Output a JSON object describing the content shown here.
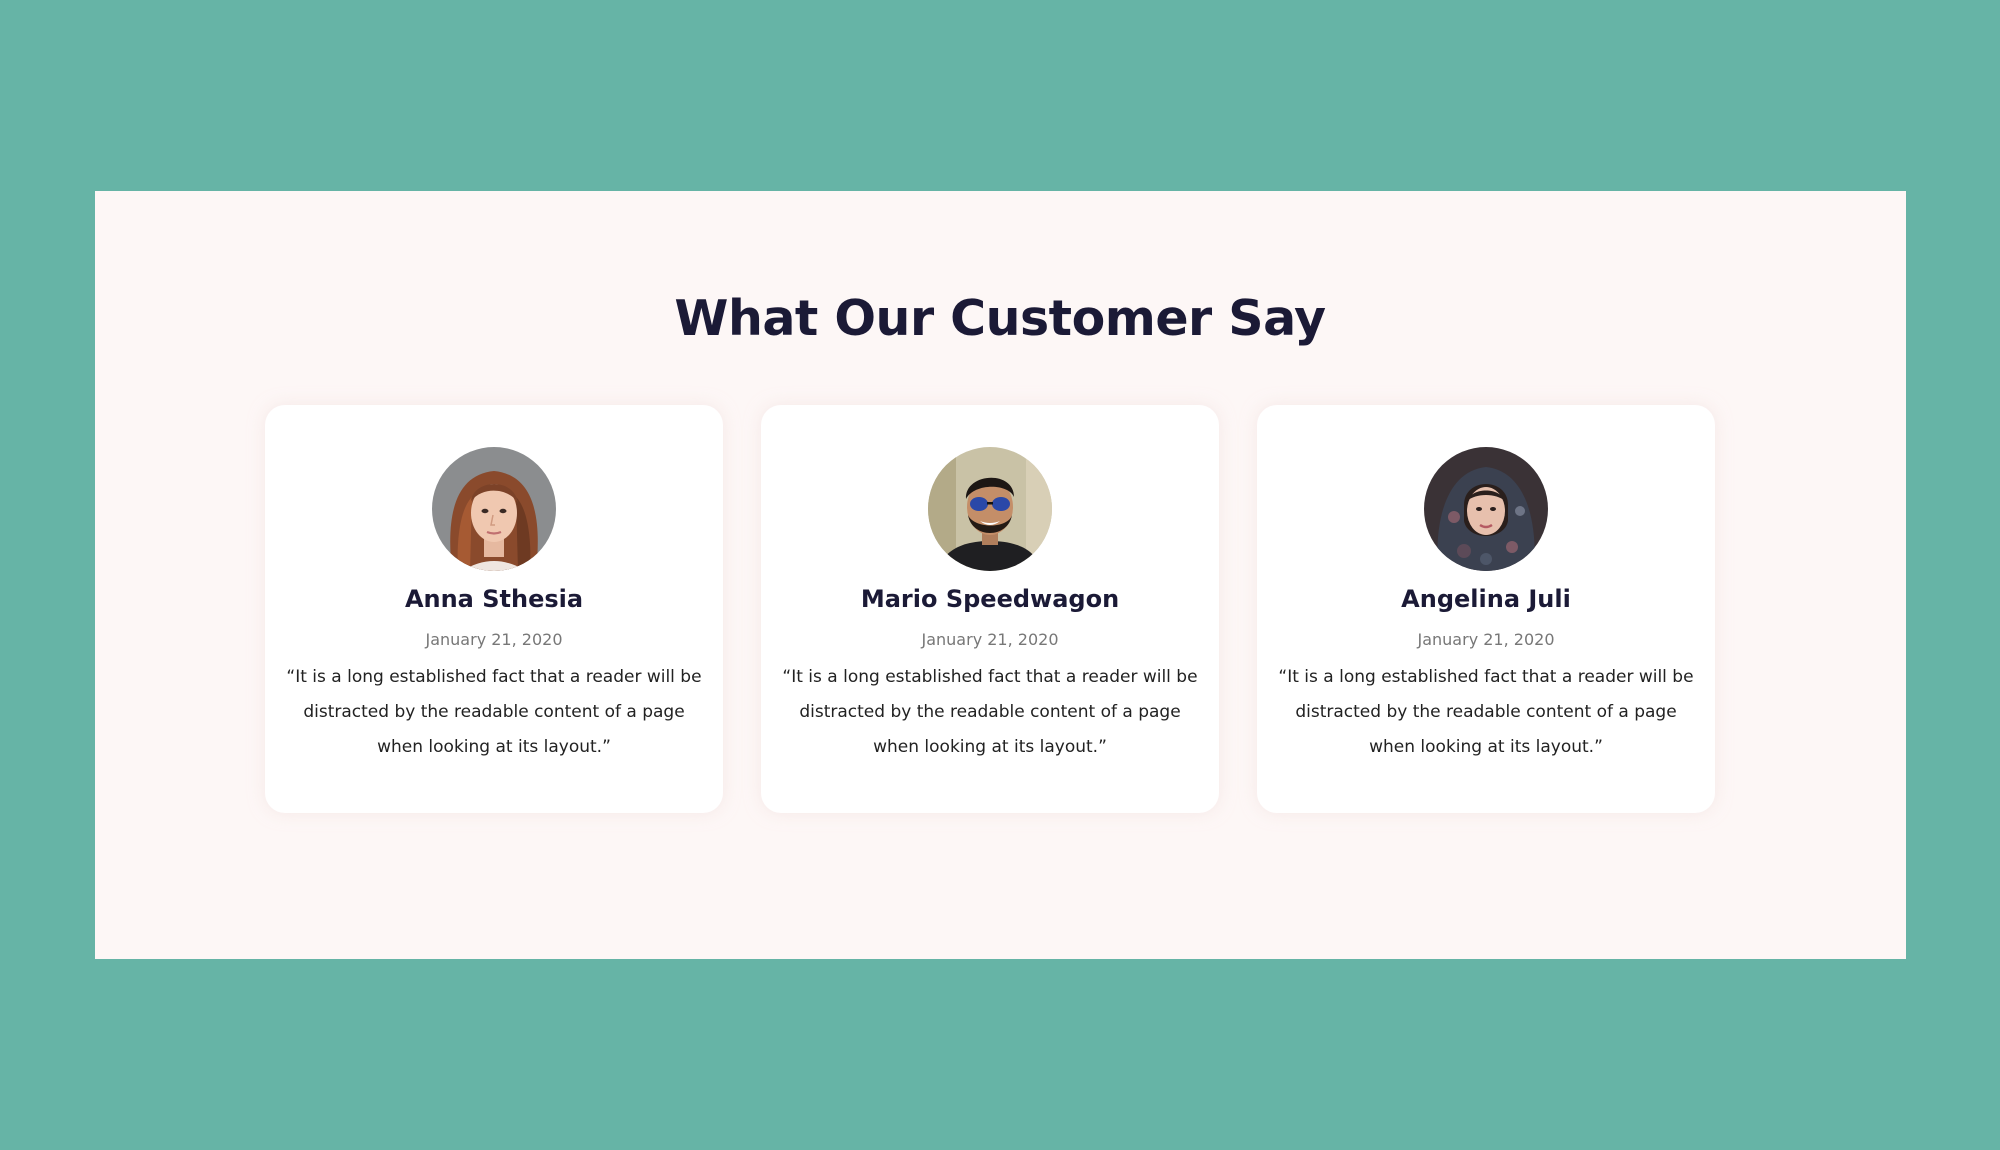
{
  "colors": {
    "background": "#66b4a6",
    "panel": "#fdf7f6",
    "card": "#ffffff",
    "heading": "#1b1a36",
    "date": "#777777",
    "text": "#222222"
  },
  "section": {
    "title": "What Our Customer Say"
  },
  "testimonials": [
    {
      "name": "Anna Sthesia",
      "date": "January 21, 2020",
      "quote": "“It is a long established fact that a reader will be distracted by the readable content of a page when looking at its layout.”",
      "avatar_icon": "avatar-woman-auburn-hair"
    },
    {
      "name": "Mario Speedwagon",
      "date": "January 21, 2020",
      "quote": "“It is a long established fact that a reader will be distracted by the readable content of a page when looking at its layout.”",
      "avatar_icon": "avatar-man-sunglasses"
    },
    {
      "name": "Angelina Juli",
      "date": "January 21, 2020",
      "quote": "“It is a long established fact that a reader will be distracted by the readable content of a page when looking at its layout.”",
      "avatar_icon": "avatar-woman-headscarf"
    }
  ]
}
